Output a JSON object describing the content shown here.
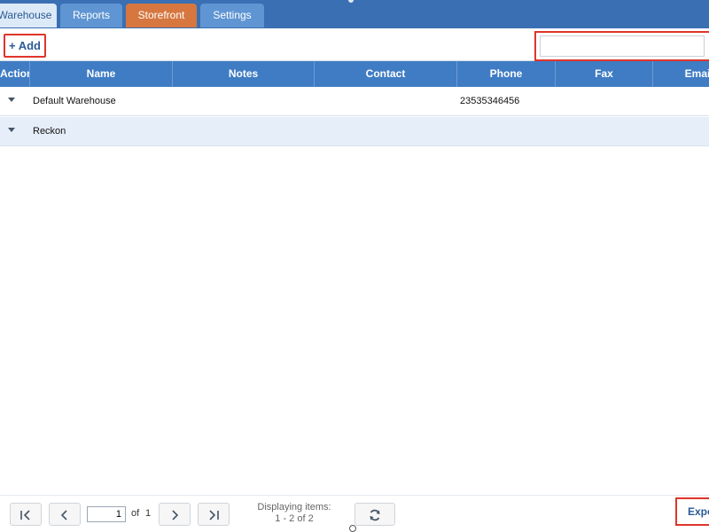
{
  "tabs": [
    {
      "label": "Warehouse",
      "active": true
    },
    {
      "label": "Reports"
    },
    {
      "label": "Storefront"
    },
    {
      "label": "Settings"
    }
  ],
  "toolbar": {
    "add_label": "+ Add",
    "search_value": "",
    "search_placeholder": ""
  },
  "grid": {
    "columns": [
      "Action",
      "Name",
      "Notes",
      "Contact",
      "Phone",
      "Fax",
      "Emai"
    ],
    "rows": [
      {
        "name": "Default Warehouse",
        "notes": "",
        "contact": "",
        "phone": "23535346456",
        "fax": "",
        "email": ""
      },
      {
        "name": "Reckon",
        "notes": "",
        "contact": "",
        "phone": "",
        "fax": "",
        "email": ""
      }
    ]
  },
  "pager": {
    "first_icon": "first-page-icon",
    "prev_icon": "previous-page-icon",
    "next_icon": "next-page-icon",
    "last_icon": "last-page-icon",
    "refresh_icon": "refresh-icon",
    "page_value": "1",
    "of_label": "of",
    "total_pages": "1",
    "displaying_label": "Displaying items:",
    "displaying_range": "1 - 2 of 2",
    "export_label": "Export"
  },
  "colors": {
    "tab_bar": "#3a6fb3",
    "header": "#3f7cc4",
    "storefront_tab": "#d6773f",
    "highlight_border": "#e0352b",
    "alt_row": "#e6eef9"
  }
}
